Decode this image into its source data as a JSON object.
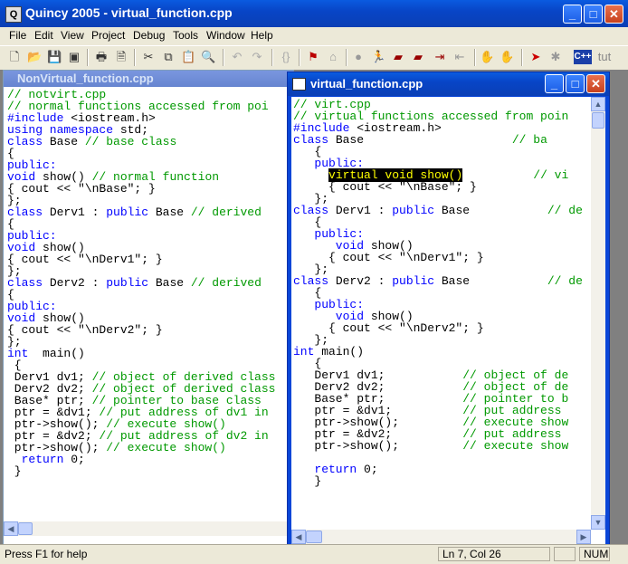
{
  "app": {
    "title": "Quincy 2005 - virtual_function.cpp",
    "icon_letter": "Q"
  },
  "menu": [
    "File",
    "Edit",
    "View",
    "Project",
    "Debug",
    "Tools",
    "Window",
    "Help"
  ],
  "toolbar": {
    "tut_label": "tut",
    "cpp_label": "C++"
  },
  "back_window": {
    "title": "NonVirtual_function.cpp",
    "lines": [
      [
        [
          "// notvirt.cpp",
          "cm"
        ]
      ],
      [
        [
          "// normal functions accessed from poi",
          "cm"
        ]
      ],
      [
        [
          "#include ",
          "kw"
        ],
        [
          "<iostream.h>",
          ""
        ]
      ],
      [
        [
          "using namespace ",
          "kw"
        ],
        [
          "std;",
          ""
        ]
      ],
      [
        [
          "class ",
          "kw"
        ],
        [
          "Base ",
          ""
        ],
        [
          "// base class",
          "cm"
        ]
      ],
      [
        [
          "{",
          ""
        ]
      ],
      [
        [
          "public:",
          "kw"
        ]
      ],
      [
        [
          "void ",
          "kw"
        ],
        [
          "show() ",
          ""
        ],
        [
          "// normal function",
          "cm"
        ]
      ],
      [
        [
          "{ cout << \"\\nBase\"; }",
          ""
        ]
      ],
      [
        [
          "};",
          ""
        ]
      ],
      [
        [
          "class ",
          "kw"
        ],
        [
          "Derv1 : ",
          ""
        ],
        [
          "public ",
          "kw"
        ],
        [
          "Base ",
          ""
        ],
        [
          "// derived",
          "cm"
        ]
      ],
      [
        [
          "{",
          ""
        ]
      ],
      [
        [
          "public:",
          "kw"
        ]
      ],
      [
        [
          "void ",
          "kw"
        ],
        [
          "show()",
          ""
        ]
      ],
      [
        [
          "{ cout << \"\\nDerv1\"; }",
          ""
        ]
      ],
      [
        [
          "};",
          ""
        ]
      ],
      [
        [
          "class ",
          "kw"
        ],
        [
          "Derv2 : ",
          ""
        ],
        [
          "public ",
          "kw"
        ],
        [
          "Base ",
          ""
        ],
        [
          "// derived",
          "cm"
        ]
      ],
      [
        [
          "{",
          ""
        ]
      ],
      [
        [
          "public:",
          "kw"
        ]
      ],
      [
        [
          "void ",
          "kw"
        ],
        [
          "show()",
          ""
        ]
      ],
      [
        [
          "{ cout << \"\\nDerv2\"; }",
          ""
        ]
      ],
      [
        [
          "};",
          ""
        ]
      ],
      [
        [
          "int  ",
          "kw"
        ],
        [
          "main()",
          ""
        ]
      ],
      [
        [
          " {",
          ""
        ]
      ],
      [
        [
          " Derv1 dv1; ",
          ""
        ],
        [
          "// object of derived class",
          "cm"
        ]
      ],
      [
        [
          " Derv2 dv2; ",
          ""
        ],
        [
          "// object of derived class",
          "cm"
        ]
      ],
      [
        [
          " Base* ptr; ",
          ""
        ],
        [
          "// pointer to base class",
          "cm"
        ]
      ],
      [
        [
          " ptr = &dv1; ",
          ""
        ],
        [
          "// put address of dv1 in",
          "cm"
        ]
      ],
      [
        [
          " ptr->show(); ",
          ""
        ],
        [
          "// execute show()",
          "cm"
        ]
      ],
      [
        [
          " ptr = &dv2; ",
          ""
        ],
        [
          "// put address of dv2 in",
          "cm"
        ]
      ],
      [
        [
          " ptr->show(); ",
          ""
        ],
        [
          "// execute show()",
          "cm"
        ]
      ],
      [
        [
          "  return ",
          "kw"
        ],
        [
          "0;",
          ""
        ]
      ],
      [
        [
          " }",
          ""
        ]
      ]
    ]
  },
  "front_window": {
    "title": "virtual_function.cpp",
    "lines": [
      [
        [
          "// virt.cpp",
          "cm"
        ]
      ],
      [
        [
          "// virtual functions accessed from poin",
          "cm"
        ]
      ],
      [
        [
          "#include ",
          "kw"
        ],
        [
          "<iostream.h>",
          ""
        ]
      ],
      [
        [
          "class ",
          "kw"
        ],
        [
          "Base                     ",
          ""
        ],
        [
          "// ba",
          "cm"
        ]
      ],
      [
        [
          "   {",
          ""
        ]
      ],
      [
        [
          "   public:",
          "kw"
        ]
      ],
      [
        [
          "     ",
          ""
        ],
        [
          "virtual void show()",
          "hl"
        ],
        [
          "          ",
          ""
        ],
        [
          "// vi",
          "cm"
        ]
      ],
      [
        [
          "     { cout << \"\\nBase\"; }",
          ""
        ]
      ],
      [
        [
          "   };",
          ""
        ]
      ],
      [
        [
          "class ",
          "kw"
        ],
        [
          "Derv1 : ",
          ""
        ],
        [
          "public ",
          "kw"
        ],
        [
          "Base           ",
          ""
        ],
        [
          "// de",
          "cm"
        ]
      ],
      [
        [
          "   {",
          ""
        ]
      ],
      [
        [
          "   public:",
          "kw"
        ]
      ],
      [
        [
          "      void ",
          "kw"
        ],
        [
          "show()",
          ""
        ]
      ],
      [
        [
          "     { cout << \"\\nDerv1\"; }",
          ""
        ]
      ],
      [
        [
          "   };",
          ""
        ]
      ],
      [
        [
          "class ",
          "kw"
        ],
        [
          "Derv2 : ",
          ""
        ],
        [
          "public ",
          "kw"
        ],
        [
          "Base           ",
          ""
        ],
        [
          "// de",
          "cm"
        ]
      ],
      [
        [
          "   {",
          ""
        ]
      ],
      [
        [
          "   public:",
          "kw"
        ]
      ],
      [
        [
          "      void ",
          "kw"
        ],
        [
          "show()",
          ""
        ]
      ],
      [
        [
          "     { cout << \"\\nDerv2\"; }",
          ""
        ]
      ],
      [
        [
          "   };",
          ""
        ]
      ],
      [
        [
          "int ",
          "kw"
        ],
        [
          "main()",
          ""
        ]
      ],
      [
        [
          "   {",
          ""
        ]
      ],
      [
        [
          "   Derv1 dv1;           ",
          ""
        ],
        [
          "// object of de",
          "cm"
        ]
      ],
      [
        [
          "   Derv2 dv2;           ",
          ""
        ],
        [
          "// object of de",
          "cm"
        ]
      ],
      [
        [
          "   Base* ptr;           ",
          ""
        ],
        [
          "// pointer to b",
          "cm"
        ]
      ],
      [
        [
          "   ptr = &dv1;          ",
          ""
        ],
        [
          "// put address",
          "cm"
        ]
      ],
      [
        [
          "   ptr->show();         ",
          ""
        ],
        [
          "// execute show",
          "cm"
        ]
      ],
      [
        [
          "   ptr = &dv2;          ",
          ""
        ],
        [
          "// put address",
          "cm"
        ]
      ],
      [
        [
          "   ptr->show();         ",
          ""
        ],
        [
          "// execute show",
          "cm"
        ]
      ],
      [
        [
          "",
          ""
        ]
      ],
      [
        [
          "   return ",
          "kw"
        ],
        [
          "0;",
          ""
        ]
      ],
      [
        [
          "   }",
          ""
        ]
      ]
    ]
  },
  "status": {
    "help": "Press F1 for help",
    "position": "Ln 7, Col 26",
    "num": "NUM"
  }
}
